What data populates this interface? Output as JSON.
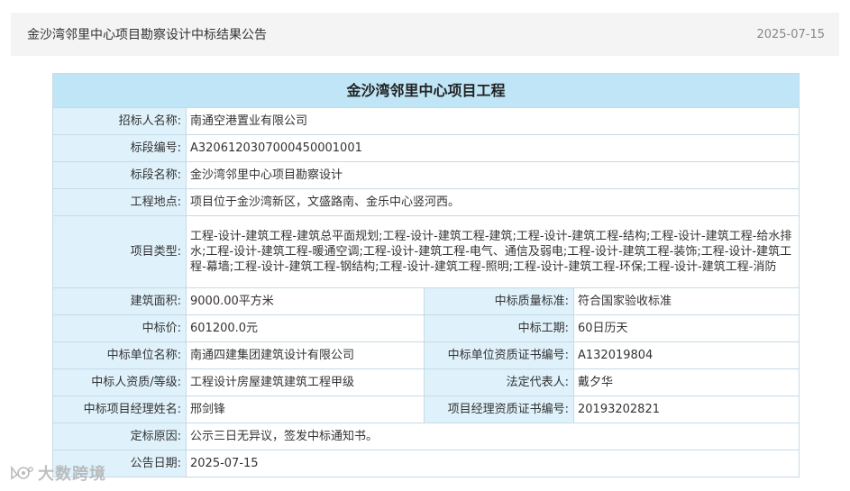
{
  "header": {
    "title": "金沙湾邻里中心项目勘察设计中标结果公告",
    "date": "2025-07-15"
  },
  "table": {
    "title": "金沙湾邻里中心项目工程",
    "tenderer": {
      "label": "招标人名称:",
      "value": "南通空港置业有限公司"
    },
    "section_no": {
      "label": "标段编号:",
      "value": "A3206120307000450001001"
    },
    "section_name": {
      "label": "标段名称:",
      "value": "金沙湾邻里中心项目勘察设计"
    },
    "location": {
      "label": "工程地点:",
      "value": "项目位于金沙湾新区，文盛路南、金乐中心竖河西。"
    },
    "project_type": {
      "label": "项目类型:",
      "value": "工程-设计-建筑工程-建筑总平面规划;工程-设计-建筑工程-建筑;工程-设计-建筑工程-结构;工程-设计-建筑工程-给水排水;工程-设计-建筑工程-暖通空调;工程-设计-建筑工程-电气、通信及弱电;工程-设计-建筑工程-装饰;工程-设计-建筑工程-幕墙;工程-设计-建筑工程-钢结构;工程-设计-建筑工程-照明;工程-设计-建筑工程-环保;工程-设计-建筑工程-消防"
    },
    "building_area": {
      "label": "建筑面积:",
      "value": "9000.00平方米"
    },
    "quality_standard": {
      "label": "中标质量标准:",
      "value": "符合国家验收标准"
    },
    "bid_price": {
      "label": "中标价:",
      "value": "601200.0元"
    },
    "duration": {
      "label": "中标工期:",
      "value": "60日历天"
    },
    "winner": {
      "label": "中标单位名称:",
      "value": "南通四建集团建筑设计有限公司"
    },
    "winner_cert_no": {
      "label": "中标单位资质证书编号:",
      "value": "A132019804"
    },
    "qualification": {
      "label": "中标人资质/等级:",
      "value": "工程设计房屋建筑建筑工程甲级"
    },
    "legal_rep": {
      "label": "法定代表人:",
      "value": "戴夕华"
    },
    "manager": {
      "label": "中标项目经理姓名:",
      "value": "邢剑锋"
    },
    "manager_cert_no": {
      "label": "项目经理资质证书编号:",
      "value": "20193202821"
    },
    "reason": {
      "label": "定标原因:",
      "value": "公示三日无异议，签发中标通知书。"
    },
    "announce_date": {
      "label": "公告日期:",
      "value": "2025-07-15"
    }
  },
  "watermark": {
    "text": "大数跨境",
    "icon": "logo-icon"
  }
}
